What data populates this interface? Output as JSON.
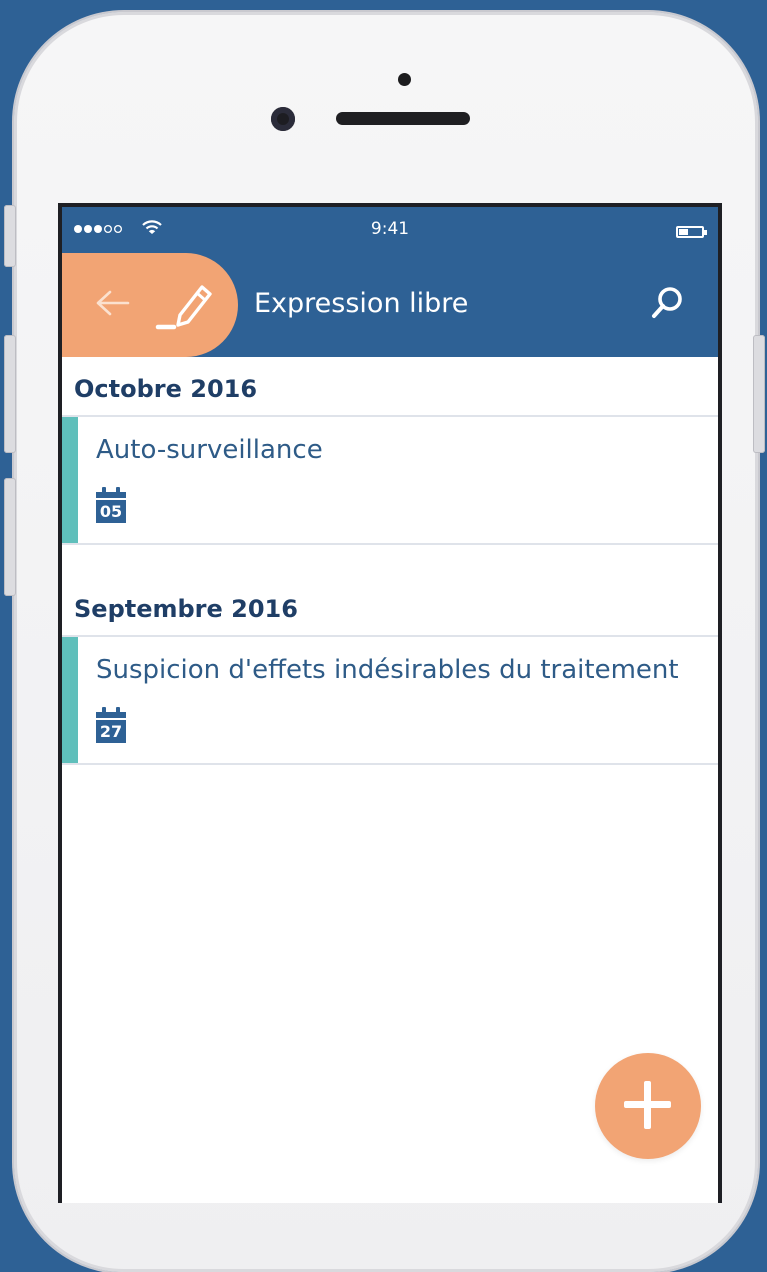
{
  "status_bar": {
    "time": "9:41",
    "signal_bars_filled": 3,
    "signal_bars_total": 5
  },
  "app_bar": {
    "title": "Expression libre",
    "back_icon": "arrow-left-icon",
    "mode_icon": "pencil-icon",
    "search_icon": "search-icon"
  },
  "sections": [
    {
      "header": "Octobre 2016",
      "entries": [
        {
          "title": "Auto-surveillance",
          "day": "05"
        }
      ]
    },
    {
      "header": "Septembre 2016",
      "entries": [
        {
          "title": "Suspicion d'effets indésirables du traitement",
          "day": "27"
        }
      ]
    }
  ],
  "fab": {
    "icon": "plus-icon"
  },
  "colors": {
    "primary": "#2e6195",
    "accent": "#f2a474",
    "entry_accent": "#5fbfbb",
    "header_text": "#1f3e66",
    "entry_text": "#2e5b87"
  }
}
